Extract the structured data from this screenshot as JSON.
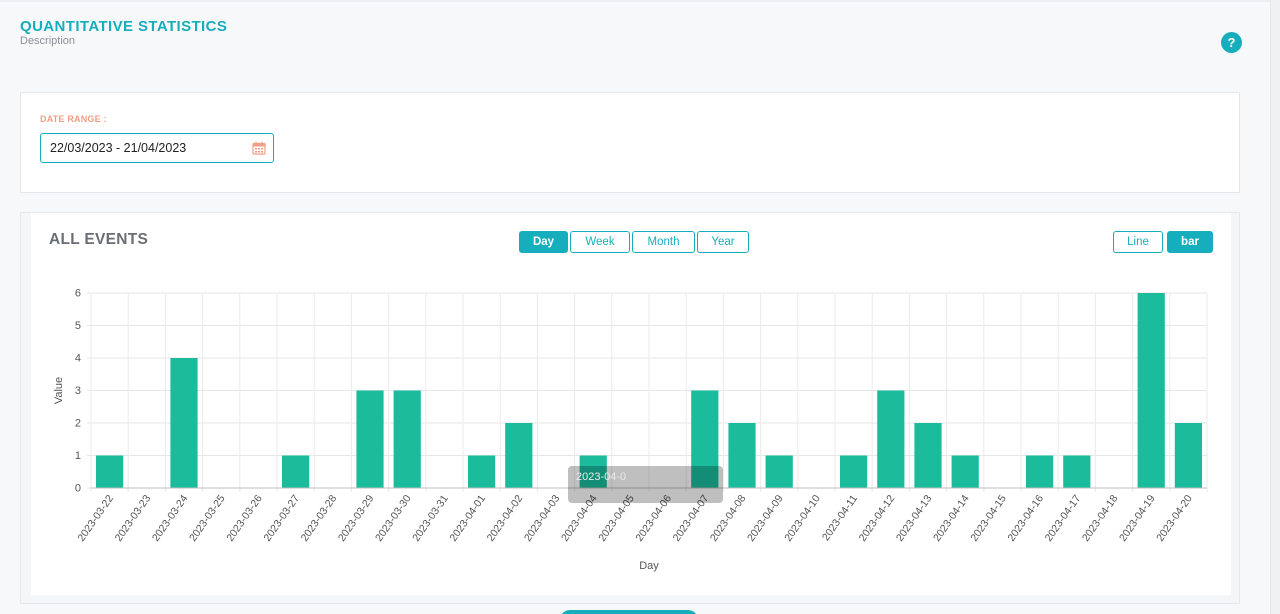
{
  "header": {
    "title": "QUANTITATIVE STATISTICS",
    "description": "Description",
    "help_glyph": "?"
  },
  "filter": {
    "label": "DATE RANGE :",
    "value": "22/03/2023 - 21/04/2023",
    "icon": "calendar-icon"
  },
  "chart_panel": {
    "title": "ALL EVENTS",
    "period_buttons": [
      "Day",
      "Week",
      "Month",
      "Year"
    ],
    "period_selected": "Day",
    "type_buttons": [
      "Line",
      "bar"
    ],
    "type_selected": "bar",
    "tooltip_label": "2023-04-0"
  },
  "colors": {
    "accent": "#16aebc",
    "bar": "#1abc9c",
    "label_orange": "#f49c84",
    "title_gray": "#6a6e74"
  },
  "chart_data": {
    "type": "bar",
    "xlabel": "Day",
    "ylabel": "Value",
    "ylim": [
      0,
      6
    ],
    "yticks": [
      0,
      1,
      2,
      3,
      4,
      5,
      6
    ],
    "grid": true,
    "categories": [
      "2023-03-22",
      "2023-03-23",
      "2023-03-24",
      "2023-03-25",
      "2023-03-26",
      "2023-03-27",
      "2023-03-28",
      "2023-03-29",
      "2023-03-30",
      "2023-03-31",
      "2023-04-01",
      "2023-04-02",
      "2023-04-03",
      "2023-04-04",
      "2023-04-05",
      "2023-04-06",
      "2023-04-07",
      "2023-04-08",
      "2023-04-09",
      "2023-04-10",
      "2023-04-11",
      "2023-04-12",
      "2023-04-13",
      "2023-04-14",
      "2023-04-15",
      "2023-04-16",
      "2023-04-17",
      "2023-04-18",
      "2023-04-19",
      "2023-04-20"
    ],
    "values": [
      1,
      0,
      4,
      0,
      0,
      1,
      0,
      3,
      3,
      0,
      1,
      2,
      0,
      1,
      0,
      0,
      3,
      2,
      1,
      0,
      1,
      3,
      2,
      1,
      0,
      1,
      1,
      0,
      6,
      2
    ]
  }
}
